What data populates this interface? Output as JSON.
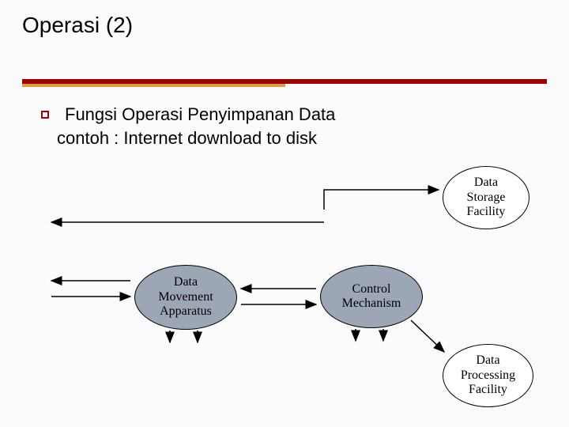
{
  "title": "Operasi (2)",
  "bullet": {
    "line1": "Fungsi Operasi Penyimpanan Data",
    "line2": "contoh : Internet download to disk"
  },
  "nodes": {
    "storage": "Data\nStorage\nFacility",
    "movement": "Data\nMovement\nApparatus",
    "control": "Control\nMechanism",
    "processing": "Data\nProcessing\nFacility"
  }
}
